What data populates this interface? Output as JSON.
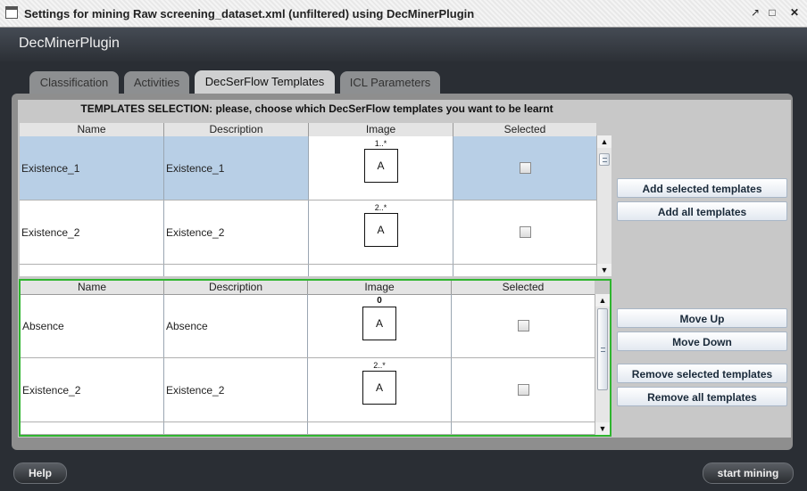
{
  "window": {
    "title": "Settings for mining Raw screening_dataset.xml (unfiltered) using DecMinerPlugin"
  },
  "header": {
    "plugin_name": "DecMinerPlugin"
  },
  "tabs": [
    {
      "label": "Classification"
    },
    {
      "label": "Activities"
    },
    {
      "label": "DecSerFlow Templates",
      "active": true
    },
    {
      "label": "ICL Parameters"
    }
  ],
  "panel": {
    "title": "TEMPLATES SELECTION: please, choose which DecSerFlow templates you want to be learnt"
  },
  "available_table": {
    "columns": [
      "Name",
      "Description",
      "Image",
      "Selected"
    ],
    "rows": [
      {
        "name": "Existence_1",
        "description": "Existence_1",
        "cardinality": "1..*",
        "box": "A",
        "selected": false
      },
      {
        "name": "Existence_2",
        "description": "Existence_2",
        "cardinality": "2..*",
        "box": "A",
        "selected": false
      }
    ]
  },
  "selected_table": {
    "columns": [
      "Name",
      "Description",
      "Image",
      "Selected"
    ],
    "rows": [
      {
        "name": "Absence",
        "description": "Absence",
        "cardinality": "0",
        "box": "A",
        "selected": false
      },
      {
        "name": "Existence_2",
        "description": "Existence_2",
        "cardinality": "2..*",
        "box": "A",
        "selected": false
      }
    ]
  },
  "buttons": {
    "add_selected": "Add selected templates",
    "add_all": "Add all templates",
    "move_up": "Move Up",
    "move_down": "Move Down",
    "remove_selected": "Remove selected templates",
    "remove_all": "Remove all templates"
  },
  "footer": {
    "help": "Help",
    "start": "start mining"
  },
  "colors": {
    "selected_row": "#b8cfe6",
    "active_border": "#2fb52f",
    "header_bg": "#2c3036"
  }
}
